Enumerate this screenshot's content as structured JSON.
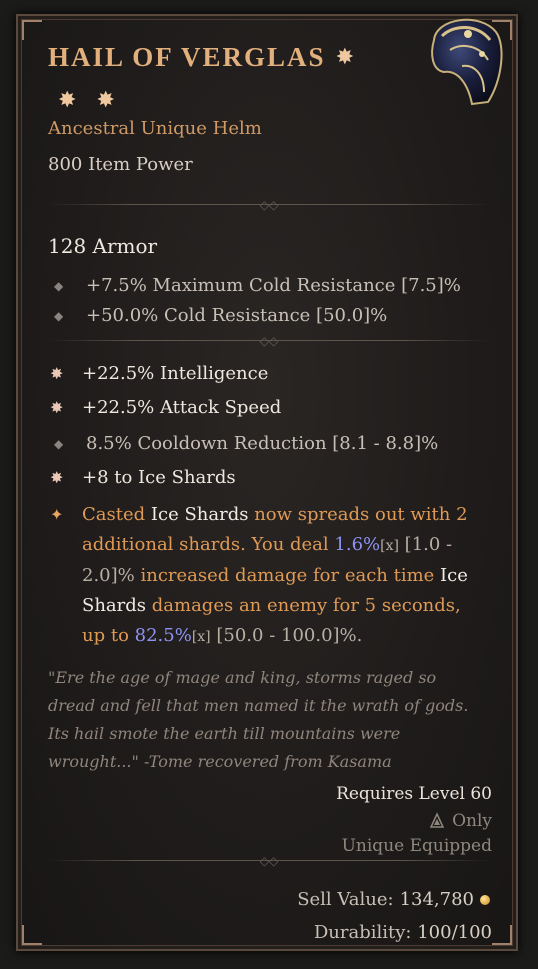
{
  "item": {
    "name": "HAIL OF VERGLAS",
    "type": "Ancestral Unique Helm",
    "item_power": "800 Item Power",
    "armor": "128 Armor",
    "implicits": [
      "+7.5% Maximum Cold Resistance [7.5]%",
      "+50.0% Cold Resistance [50.0]%"
    ],
    "affixes": [
      "+22.5% Intelligence",
      "+22.5% Attack Speed",
      "8.5% Cooldown Reduction [8.1 - 8.8]%",
      "+8 to Ice Shards"
    ],
    "unique_power": {
      "t1": "Casted ",
      "t2": "Ice Shards",
      "t3": " now spreads out with 2 additional shards. You deal ",
      "t4": "1.6%",
      "t5": "[x]",
      "t6": " [1.0 - 2.0]%",
      "t7": " increased damage for each time ",
      "t8": "Ice Shards",
      "t9": " damages an enemy for 5 seconds, up to ",
      "t10": "82.5%",
      "t11": "[x]",
      "t12": " [50.0 - 100.0]%",
      "t13": "."
    },
    "flavor": "\"Ere the age of mage and king, storms raged so dread and fell that men named it the wrath of gods. Its hail smote the earth till mountains were wrought...\" -Tome recovered from Kasama",
    "requires_level": "Requires Level 60",
    "class_only": "Only",
    "unique_equipped": "Unique Equipped",
    "sell_label": "Sell Value:",
    "sell_value": "134,780",
    "durability_label": "Durability:",
    "durability_value": "100/100",
    "icon": "helm-icon",
    "colors": {
      "title": "#e2b07c",
      "unique": "#e09a55",
      "value_blue": "#8e92f2"
    }
  }
}
